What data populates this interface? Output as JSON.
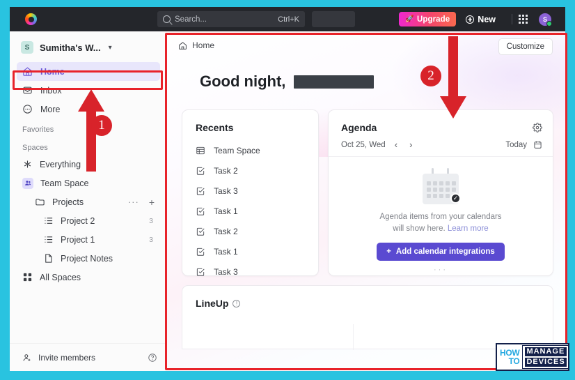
{
  "topbar": {
    "logo_name": "clickup-logo",
    "search_placeholder": "Search...",
    "search_shortcut": "Ctrl+K",
    "upgrade_label": "Upgrade",
    "new_label": "New",
    "avatar_initial": "S"
  },
  "sidebar": {
    "workspace": {
      "badge": "S",
      "name": "Sumitha's W...",
      "chevron": "⌄"
    },
    "nav": [
      {
        "label": "Home",
        "icon": "home-icon",
        "active": true
      },
      {
        "label": "Inbox",
        "icon": "inbox-icon",
        "active": false
      },
      {
        "label": "More",
        "icon": "more-icon",
        "active": false
      }
    ],
    "favorites_label": "Favorites",
    "spaces_label": "Spaces",
    "spaces": [
      {
        "label": "Everything",
        "icon": "everything-icon",
        "count": ""
      },
      {
        "label": "Team Space",
        "icon": "team-space-icon",
        "count": ""
      },
      {
        "label": "Projects",
        "icon": "folder-icon",
        "count": "",
        "dots": "···",
        "plus": "+"
      },
      {
        "label": "Project 2",
        "icon": "list-icon",
        "count": "3"
      },
      {
        "label": "Project 1",
        "icon": "list-icon",
        "count": "3"
      },
      {
        "label": "Project Notes",
        "icon": "doc-icon",
        "count": ""
      },
      {
        "label": "All Spaces",
        "icon": "all-spaces-icon",
        "count": ""
      }
    ],
    "footer": {
      "invite_label": "Invite members",
      "help_icon": "help-icon"
    }
  },
  "main": {
    "breadcrumb": "Home",
    "customize_label": "Customize",
    "greeting": "Good night,",
    "recents": {
      "title": "Recents",
      "items": [
        {
          "label": "Team Space",
          "icon": "table-icon"
        },
        {
          "label": "Task 2",
          "icon": "task-icon"
        },
        {
          "label": "Task 3",
          "icon": "task-icon"
        },
        {
          "label": "Task 1",
          "icon": "task-icon"
        },
        {
          "label": "Task 2",
          "icon": "task-icon"
        },
        {
          "label": "Task 1",
          "icon": "task-icon"
        },
        {
          "label": "Task 3",
          "icon": "task-icon"
        }
      ]
    },
    "agenda": {
      "title": "Agenda",
      "settings_icon": "gear-icon",
      "date": "Oct 25, Wed",
      "prev": "‹",
      "next": "›",
      "today_label": "Today",
      "calendar_icon": "calendar-icon",
      "empty_line1": "Agenda items from your calendars",
      "empty_line2_pre": "will show here. ",
      "empty_link": "Learn more",
      "add_button": "Add calendar integrations",
      "add_button_plus": "+",
      "dots_hint": "···"
    },
    "lineup": {
      "title": "LineUp",
      "info_icon": "info-icon",
      "info_glyph": "!"
    }
  },
  "annotations": {
    "badge1": "1",
    "badge2": "2",
    "accent_red": "#d8232a",
    "box_red": "#e8232a"
  },
  "watermark": {
    "how": "HOW",
    "to": "TO",
    "manage": "MANAGE",
    "devices": "DEVICES"
  }
}
